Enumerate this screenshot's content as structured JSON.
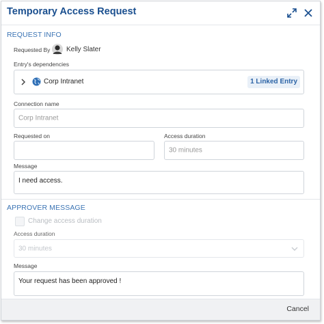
{
  "dialog": {
    "title": "Temporary Access Request",
    "expand_icon": "expand-icon",
    "close_icon": "close-icon"
  },
  "request_info": {
    "section_title": "REQUEST INFO",
    "requested_by_label": "Requested By",
    "requested_by_name": "Kelly Slater",
    "dependencies_label": "Entry's dependencies",
    "dependency_name": "Corp Intranet",
    "linked_entry_badge": "1 Linked Entry",
    "connection_name_label": "Connection name",
    "connection_name_value": "Corp Intranet",
    "requested_on_label": "Requested on",
    "requested_on_value": "",
    "access_duration_label": "Access duration",
    "access_duration_value": "30 minutes",
    "message_label": "Message",
    "message_value": "I need access."
  },
  "approver_message": {
    "section_title": "APPROVER MESSAGE",
    "change_duration_label": "Change access duration",
    "change_duration_checked": false,
    "access_duration_label": "Access duration",
    "access_duration_value": "30 minutes",
    "message_label": "Message",
    "message_value": "Your request has been approved !"
  },
  "footer": {
    "cancel_label": "Cancel"
  },
  "colors": {
    "accent": "#1a4f8f",
    "section": "#3b74b4",
    "badge_bg": "#e9f0f8"
  }
}
